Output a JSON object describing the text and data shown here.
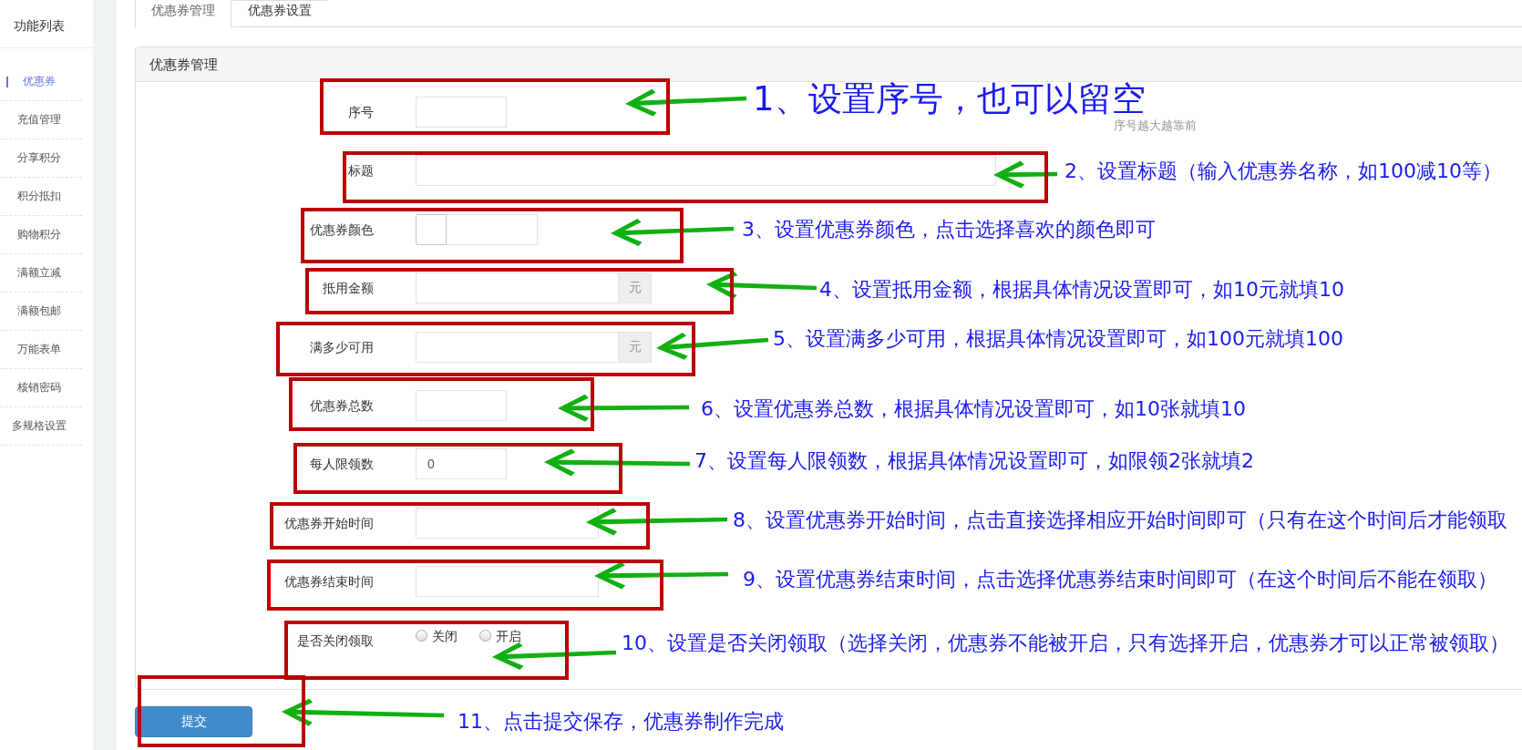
{
  "sidebar": {
    "title": "功能列表",
    "items": [
      {
        "label": "优惠券",
        "selected": true
      },
      {
        "label": "充值管理",
        "selected": false
      },
      {
        "label": "分享积分",
        "selected": false
      },
      {
        "label": "积分抵扣",
        "selected": false
      },
      {
        "label": "购物积分",
        "selected": false
      },
      {
        "label": "满额立减",
        "selected": false
      },
      {
        "label": "满额包邮",
        "selected": false
      },
      {
        "label": "万能表单",
        "selected": false
      },
      {
        "label": "核销密码",
        "selected": false
      },
      {
        "label": "多规格设置",
        "selected": false
      }
    ]
  },
  "tabs": [
    {
      "label": "优惠券管理",
      "selected": true
    },
    {
      "label": "优惠券设置",
      "selected": false
    }
  ],
  "panel": {
    "title": "优惠券管理",
    "fields": [
      {
        "kind": "number",
        "label": "序号",
        "help": "序号越大越靠前"
      },
      {
        "kind": "text",
        "label": "标题"
      },
      {
        "kind": "color",
        "label": "优惠券颜色"
      },
      {
        "kind": "money",
        "label": "抵用金额",
        "unit": "元"
      },
      {
        "kind": "money",
        "label": "满多少可用",
        "unit": "元"
      },
      {
        "kind": "number",
        "label": "优惠券总数"
      },
      {
        "kind": "number",
        "label": "每人限领数",
        "value": "0"
      },
      {
        "kind": "date",
        "label": "优惠券开始时间"
      },
      {
        "kind": "date",
        "label": "优惠券结束时间"
      },
      {
        "kind": "radio",
        "label": "是否关闭领取",
        "options": [
          {
            "label": "关闭",
            "selected": false
          },
          {
            "label": "开启",
            "selected": false
          }
        ]
      }
    ]
  },
  "submit_button": {
    "label": "提交"
  },
  "annotations": [
    "1、设置序号，也可以留空",
    "2、设置标题（输入优惠券名称，如100减10等）",
    "3、设置优惠券颜色，点击选择喜欢的颜色即可",
    "4、设置抵用金额，根据具体情况设置即可，如10元就填10",
    "5、设置满多少可用，根据具体情况设置即可，如100元就填100",
    "6、设置优惠券总数，根据具体情况设置即可，如10张就填10",
    "7、设置每人限领数，根据具体情况设置即可，如限领2张就填2",
    "8、设置优惠券开始时间，点击直接选择相应开始时间即可（只有在这个时间后才能领取",
    "9、设置优惠券结束时间，点击选择优惠券结束时间即可（在这个时间后不能在领取）",
    "10、设置是否关闭领取（选择关闭，优惠券不能被开启，只有选择开启，优惠券才可以正常被领取）",
    "11、点击提交保存，优惠券制作完成"
  ]
}
